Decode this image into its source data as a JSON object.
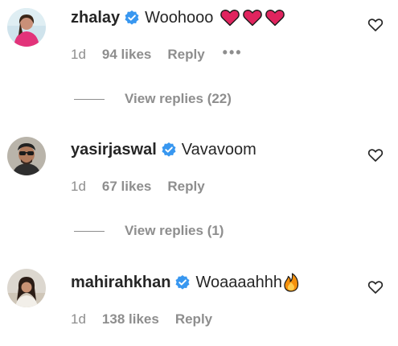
{
  "comments": [
    {
      "username": "zhalay",
      "verified": true,
      "text": "Woohooo",
      "emojis": [
        "red-heart",
        "red-heart",
        "red-heart"
      ],
      "time": "1d",
      "likes": "94 likes",
      "reply_label": "Reply",
      "more_label": "•••",
      "view_replies": "View replies (22)"
    },
    {
      "username": "yasirjaswal",
      "verified": true,
      "text": "Vavavoom",
      "time": "1d",
      "likes": "67 likes",
      "reply_label": "Reply",
      "view_replies": "View replies (1)"
    },
    {
      "username": "mahirahkhan",
      "verified": true,
      "text": "Woaaaahhh",
      "emojis": [
        "fire"
      ],
      "time": "1d",
      "likes": "138 likes",
      "reply_label": "Reply"
    }
  ],
  "colors": {
    "text": "#262626",
    "meta": "#8e8e8e",
    "verified_badge": "#3897f0",
    "heart_emoji": "#e0245e",
    "fire_emoji": "#f4900c"
  }
}
